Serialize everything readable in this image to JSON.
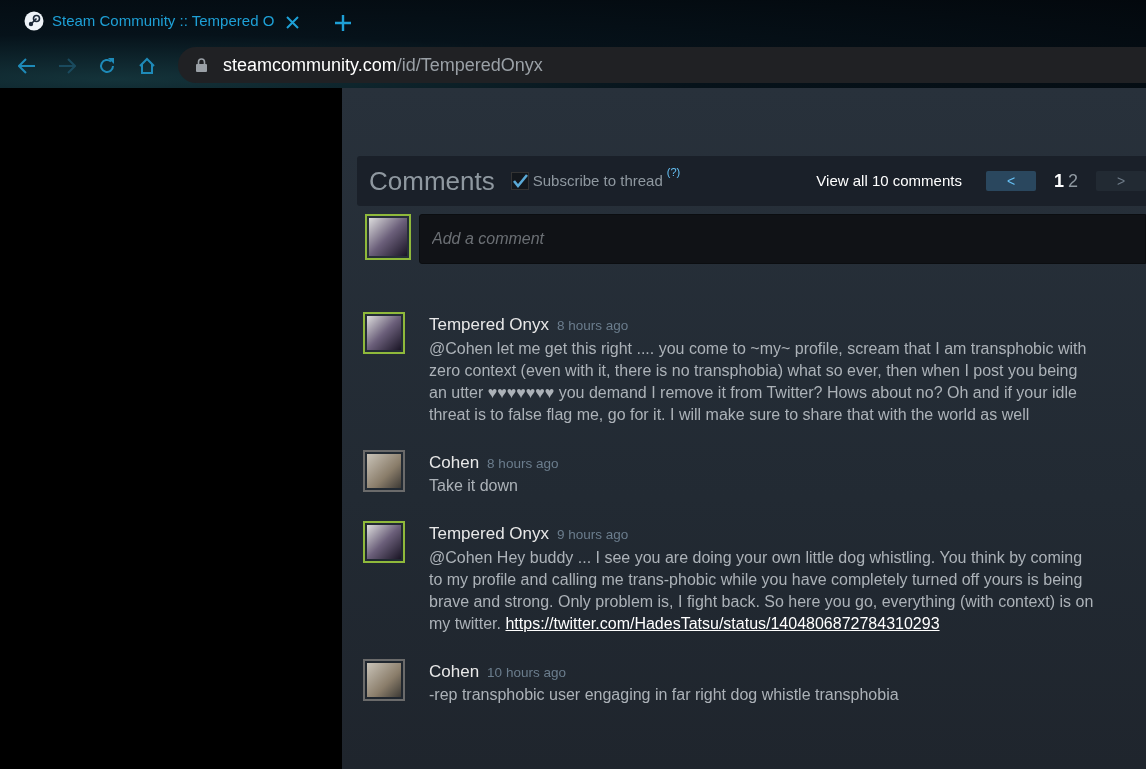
{
  "browser": {
    "tab_title": "Steam Community :: Tempered O",
    "url_host": "steamcommunity.com",
    "url_path": "/id/TemperedOnyx",
    "forward_disabled": true
  },
  "comments_header": {
    "title": "Comments",
    "subscribe": {
      "label": "Subscribe to thread",
      "checked": true
    },
    "help": "(?)",
    "view_all": "View all 10 comments",
    "prev": "<",
    "next": ">",
    "next_disabled": true,
    "pages": [
      {
        "label": "1",
        "selected": true
      },
      {
        "label": "2",
        "selected": false
      }
    ]
  },
  "add_comment": {
    "placeholder": "Add a comment",
    "color": "#8fb93b"
  },
  "comments": [
    {
      "author": "Tempered Onyx",
      "time": "8 hours ago",
      "color": "#8fb93b",
      "text": "@Cohen let me get this right .... you come to ~my~ profile, scream that I am transphobic with zero context (even with it, there is no transphobia) what so ever, then when I post you being an utter ♥♥♥♥♥♥♥ you demand I remove it from Twitter? Hows about no? Oh and if your idle threat is to false flag me, go for it. I will make sure to share that with the world as well"
    },
    {
      "author": "Cohen",
      "time": "8 hours ago",
      "color": "#6b6b6b",
      "text": "Take it down"
    },
    {
      "author": "Tempered Onyx",
      "time": "9 hours ago",
      "color": "#8fb93b",
      "text": "@Cohen Hey buddy ... I see you are doing your own little dog whistling. You think by coming to my profile and calling me trans-phobic while you have completely turned off yours is being brave and strong. Only problem is, I fight back. So here you go, everything (with context) is on my twitter.",
      "link": "https://twitter.com/HadesTatsu/status/1404806872784310293"
    },
    {
      "author": "Cohen",
      "time": "10 hours ago",
      "color": "#6b6b6b",
      "text": "-rep transphobic user engaging in far right dog whistle transphobia"
    }
  ]
}
